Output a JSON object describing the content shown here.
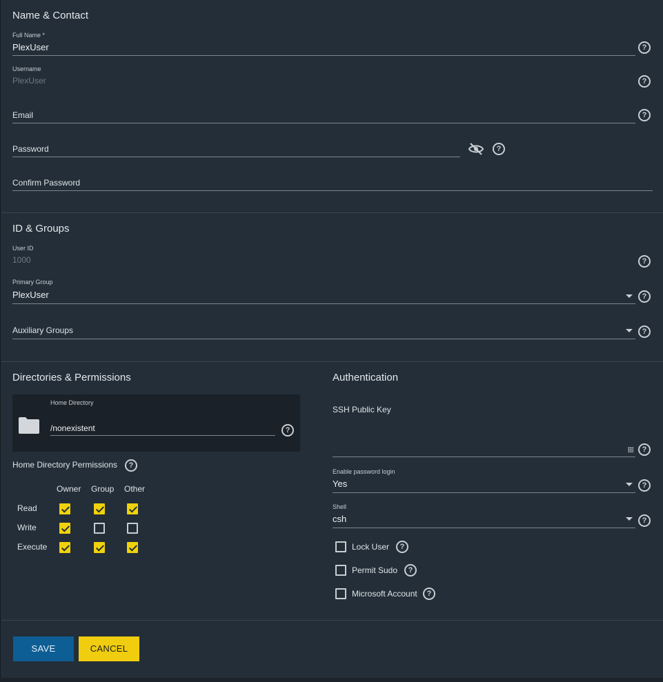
{
  "name_contact": {
    "title": "Name & Contact",
    "full_name": {
      "label": "Full Name *",
      "value": "PlexUser"
    },
    "username": {
      "label": "Username",
      "value": "PlexUser"
    },
    "email": {
      "placeholder": "Email"
    },
    "password": {
      "placeholder": "Password"
    },
    "confirm_password": {
      "placeholder": "Confirm Password"
    }
  },
  "id_groups": {
    "title": "ID & Groups",
    "user_id": {
      "label": "User ID",
      "value": "1000"
    },
    "primary_group": {
      "label": "Primary Group",
      "value": "PlexUser"
    },
    "auxiliary_groups": {
      "placeholder": "Auxiliary Groups"
    }
  },
  "directories": {
    "title": "Directories & Permissions",
    "home_directory": {
      "label": "Home Directory",
      "value": "/nonexistent"
    },
    "permissions_title": "Home Directory Permissions",
    "columns": [
      "Owner",
      "Group",
      "Other"
    ],
    "rows": [
      {
        "label": "Read",
        "checks": [
          true,
          true,
          true
        ]
      },
      {
        "label": "Write",
        "checks": [
          true,
          false,
          false
        ]
      },
      {
        "label": "Execute",
        "checks": [
          true,
          true,
          true
        ]
      }
    ]
  },
  "authentication": {
    "title": "Authentication",
    "ssh_key": {
      "placeholder": "SSH Public Key"
    },
    "password_login": {
      "label": "Enable password login",
      "value": "Yes"
    },
    "shell": {
      "label": "Shell",
      "value": "csh"
    },
    "lock_user": {
      "label": "Lock User",
      "checked": false
    },
    "permit_sudo": {
      "label": "Permit Sudo",
      "checked": false
    },
    "microsoft_account": {
      "label": "Microsoft Account",
      "checked": false
    }
  },
  "actions": {
    "save_label": "SAVE",
    "cancel_label": "CANCEL"
  },
  "icons": {
    "help": "help-circle-icon",
    "visibility": "eye-off-icon",
    "folder": "folder-icon",
    "dropdown": "caret-down-icon"
  },
  "colors": {
    "background": "#232e38",
    "save_button": "#0e5e96",
    "cancel_button": "#f0cd0e",
    "checkbox_checked": "#f0d20c"
  }
}
